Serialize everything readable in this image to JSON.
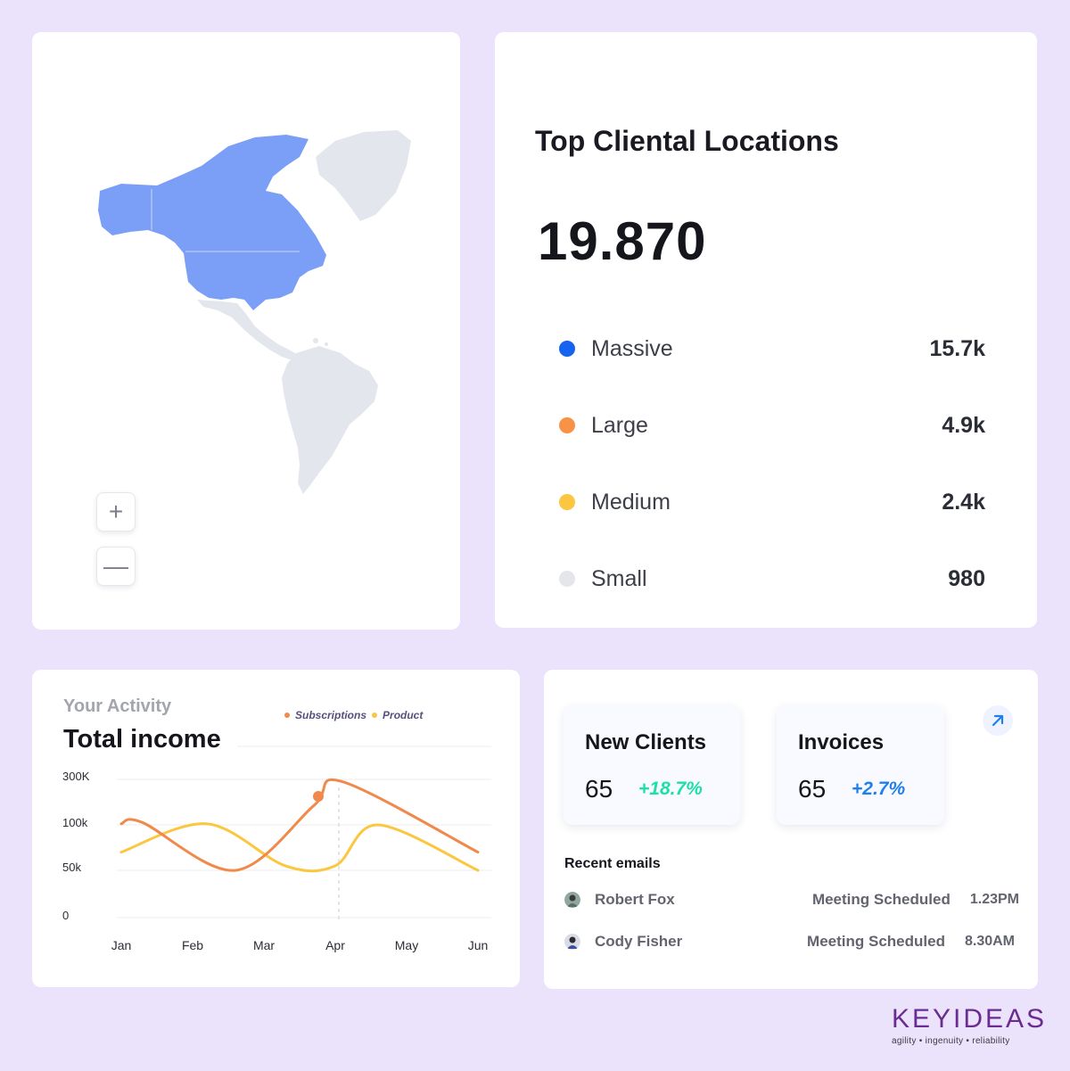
{
  "map": {
    "zoom_in_label": "+",
    "zoom_out_label": "—",
    "highlight_color": "#7b9ef6",
    "base_color": "#e4e6ee"
  },
  "locations": {
    "title": "Top Cliental Locations",
    "total": "19.870",
    "rows": [
      {
        "label": "Massive",
        "value": "15.7k",
        "color": "#1663f0"
      },
      {
        "label": "Large",
        "value": "4.9k",
        "color": "#f79246"
      },
      {
        "label": "Medium",
        "value": "2.4k",
        "color": "#fbc640"
      },
      {
        "label": "Small",
        "value": "980",
        "color": "#e5e6ec"
      }
    ]
  },
  "activity": {
    "subtitle": "Your Activity",
    "title": "Total income",
    "legend": [
      {
        "name": "Subscriptions",
        "color": "#f0894a"
      },
      {
        "name": "Product",
        "color": "#fbc640"
      }
    ]
  },
  "chart_data": {
    "type": "line",
    "categories": [
      "Jan",
      "Feb",
      "Mar",
      "Apr",
      "May",
      "Jun"
    ],
    "y_ticks": [
      "300K",
      "100k",
      "50k",
      "0"
    ],
    "series": [
      {
        "name": "Subscriptions",
        "color": "#f0894a",
        "x": [
          0,
          0.3,
          1.6,
          2.7,
          3.1,
          5.0
        ],
        "values": [
          105,
          110,
          50,
          185,
          290,
          70
        ]
      },
      {
        "name": "Product",
        "color": "#fbc640",
        "x": [
          0,
          1.2,
          2.3,
          3.0,
          3.6,
          5.0
        ],
        "values": [
          70,
          105,
          55,
          55,
          100,
          50
        ]
      }
    ],
    "highlight": {
      "series": "Subscriptions",
      "x": 2.75,
      "value": 220
    },
    "grid": true,
    "legend_position": "top"
  },
  "summary": {
    "clients": {
      "title": "New Clients",
      "value": "65",
      "delta": "+18.7%"
    },
    "invoices": {
      "title": "Invoices",
      "value": "65",
      "delta": "+2.7%"
    },
    "emails_title": "Recent emails",
    "emails": [
      {
        "name": "Robert Fox",
        "subject": "Meeting Scheduled",
        "time": "1.23PM"
      },
      {
        "name": "Cody Fisher",
        "subject": "Meeting Scheduled",
        "time": "8.30AM"
      }
    ]
  },
  "brand": {
    "name": "KEYIDEAS",
    "tagline": "agility  •  ingenuity  •  reliability"
  }
}
